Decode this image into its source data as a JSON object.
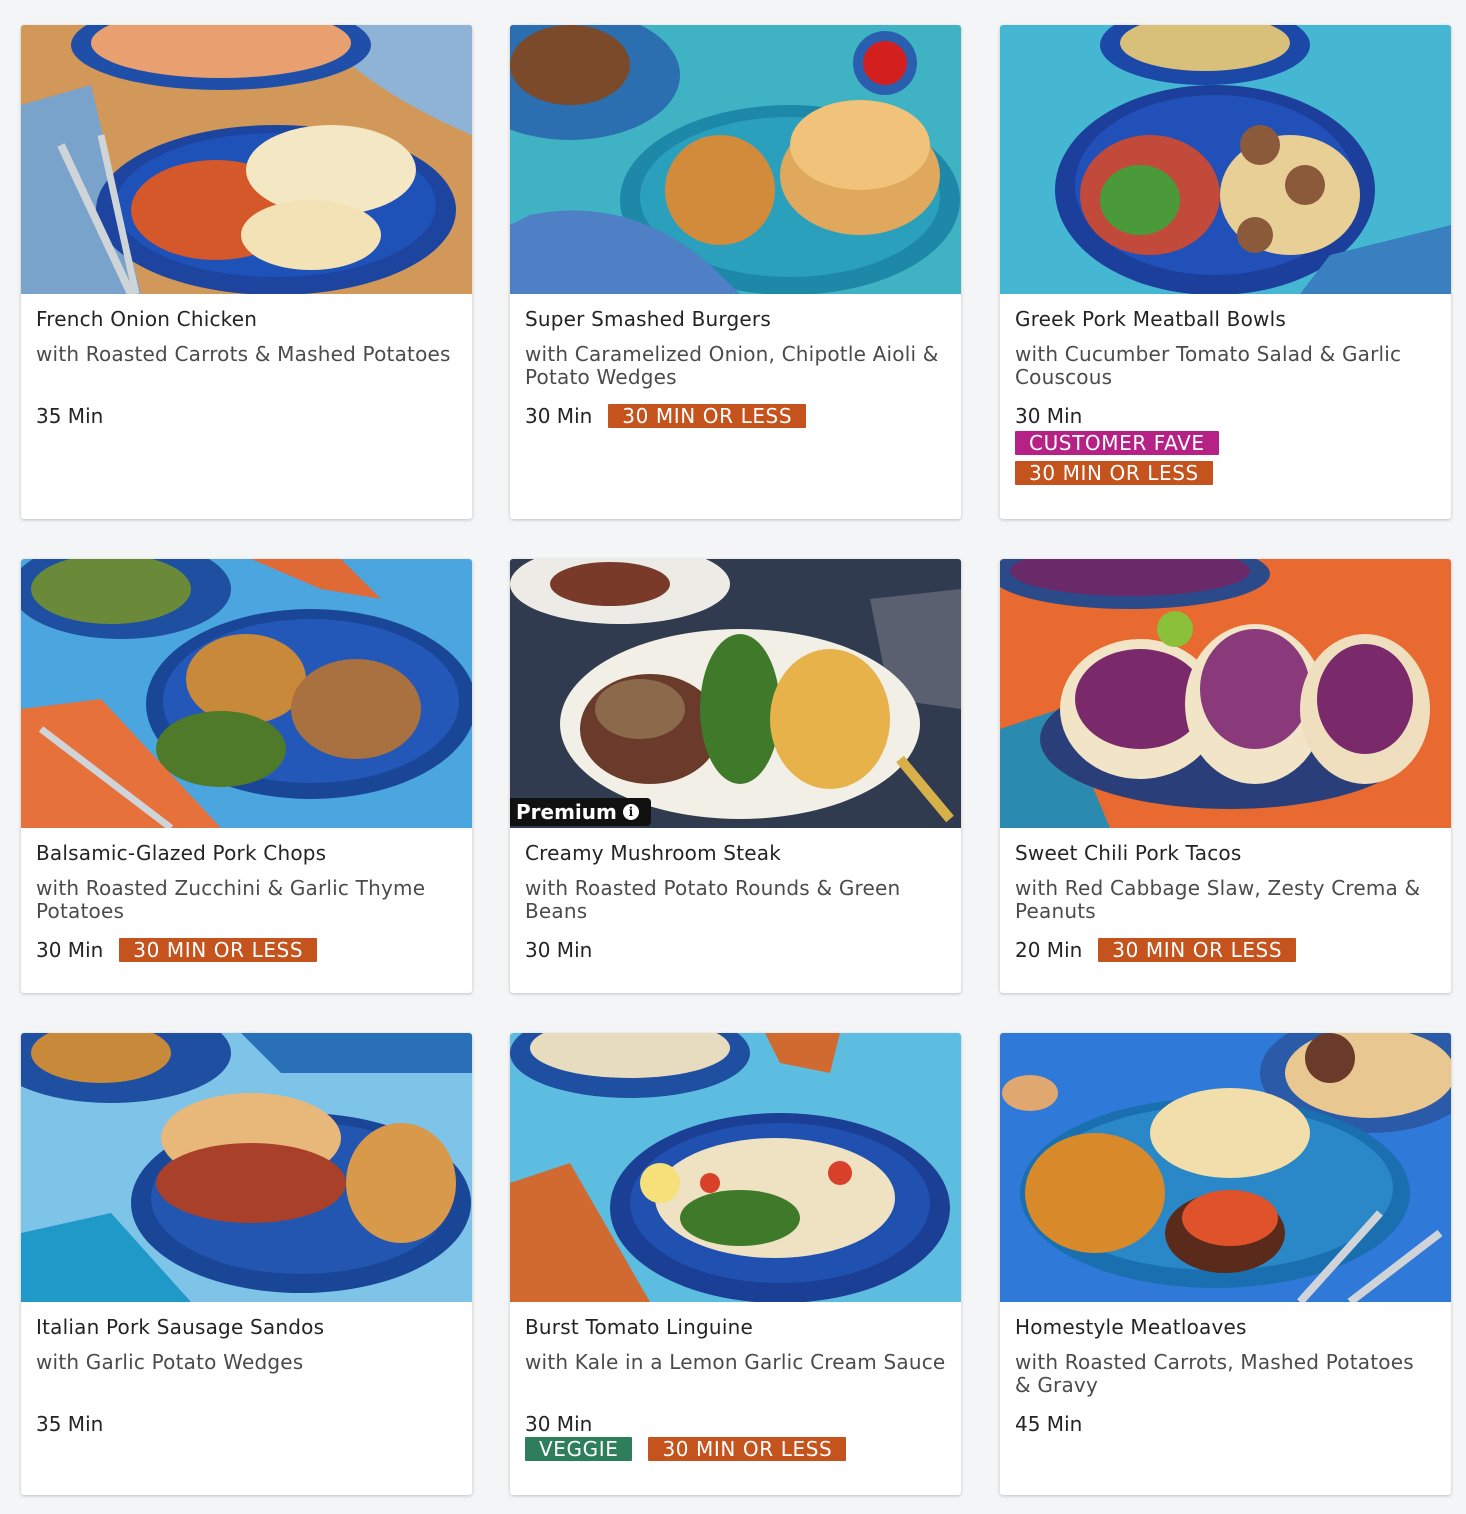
{
  "recipes": [
    {
      "title": "French Onion Chicken",
      "subtitle": "with Roasted Carrots & Mashed Potatoes",
      "time": "35 Min",
      "tags": []
    },
    {
      "title": "Super Smashed Burgers",
      "subtitle": "with Caramelized Onion, Chipotle Aioli & Potato Wedges",
      "time": "30 Min",
      "tags": [
        "30 MIN OR LESS"
      ]
    },
    {
      "title": "Greek Pork Meatball Bowls",
      "subtitle": "with Cucumber Tomato Salad & Garlic Couscous",
      "time": "30 Min",
      "tags": [
        "CUSTOMER FAVE",
        "30 MIN OR LESS"
      ]
    },
    {
      "title": "Balsamic-Glazed Pork Chops",
      "subtitle": "with Roasted Zucchini & Garlic Thyme Potatoes",
      "time": "30 Min",
      "tags": [
        "30 MIN OR LESS"
      ]
    },
    {
      "title": "Creamy Mushroom Steak",
      "subtitle": "with Roasted Potato Rounds & Green Beans",
      "time": "30 Min",
      "tags": [],
      "badge": "Premium"
    },
    {
      "title": "Sweet Chili Pork Tacos",
      "subtitle": "with Red Cabbage Slaw, Zesty Crema & Peanuts",
      "time": "20 Min",
      "tags": [
        "30 MIN OR LESS"
      ]
    },
    {
      "title": "Italian Pork Sausage Sandos",
      "subtitle": "with Garlic Potato Wedges",
      "time": "35 Min",
      "tags": []
    },
    {
      "title": "Burst Tomato Linguine",
      "subtitle": "with Kale in a Lemon Garlic Cream Sauce",
      "time": "30 Min",
      "tags": [
        "VEGGIE",
        "30 MIN OR LESS"
      ]
    },
    {
      "title": "Homestyle Meatloaves",
      "subtitle": "with Roasted Carrots, Mashed Potatoes & Gravy",
      "time": "45 Min",
      "tags": []
    }
  ],
  "colors": {
    "tag_quick": "#c4531e",
    "tag_fave": "#b62185",
    "tag_veggie": "#2e7d5b",
    "premium_badge": "#111111"
  },
  "icons": {
    "premium_info": "info-icon"
  }
}
